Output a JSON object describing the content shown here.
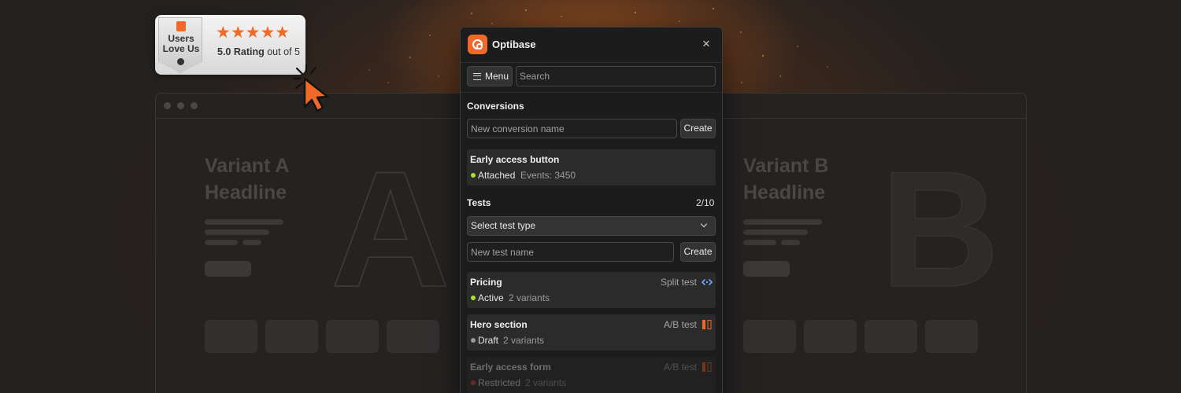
{
  "badge": {
    "shield_line1": "Users",
    "shield_line2": "Love Us",
    "stars": "★★★★★",
    "rating_strong": "5.0 Rating",
    "rating_rest": " out of 5"
  },
  "background": {
    "variant_a_line1": "Variant A",
    "variant_a_line2": "Headline",
    "letter_a": "A",
    "variant_b_line1": "Variant B",
    "variant_b_line2": "Headline",
    "letter_b": "B"
  },
  "panel": {
    "app_name": "Optibase",
    "close_icon": "×",
    "menu_label": "Menu",
    "search_placeholder": "Search",
    "conversions": {
      "title": "Conversions",
      "new_placeholder": "New conversion name",
      "create_label": "Create",
      "items": [
        {
          "name": "Early access button",
          "status": "Attached",
          "meta": "Events: 3450",
          "status_color": "#a6e22e"
        }
      ]
    },
    "tests": {
      "title": "Tests",
      "count": "2/10",
      "select_label": "Select test type",
      "new_placeholder": "New test name",
      "create_label": "Create",
      "items": [
        {
          "name": "Pricing",
          "type": "Split test",
          "type_icon": "split-arrows-icon",
          "status": "Active",
          "meta": "2 variants",
          "status_color": "#a6e22e"
        },
        {
          "name": "Hero section",
          "type": "A/B test",
          "type_icon": "ab-columns-icon",
          "status": "Draft",
          "meta": "2 variants",
          "status_color": "#9a9a9a"
        },
        {
          "name": "Early access form",
          "type": "A/B test",
          "type_icon": "ab-columns-icon",
          "status": "Restricted",
          "meta": "2 variants",
          "status_color": "#e0452a"
        }
      ]
    }
  },
  "colors": {
    "accent": "#ef6a28",
    "panel_bg": "#1c1c1c",
    "active": "#a6e22e",
    "split_icon": "#6ea8ff"
  }
}
